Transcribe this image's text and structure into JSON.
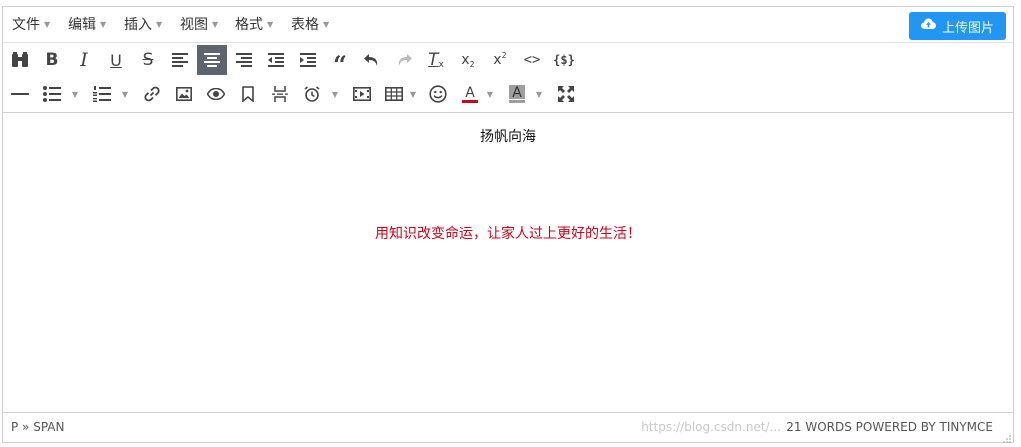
{
  "menubar": {
    "items": [
      "文件",
      "编辑",
      "插入",
      "视图",
      "格式",
      "表格"
    ]
  },
  "upload_button": {
    "label": "上传图片",
    "icon": "cloud-upload-icon",
    "color": "#2196f3"
  },
  "toolbar": {
    "row1": [
      "binoculars-icon",
      "bold-icon",
      "italic-icon",
      "underline-icon",
      "strikethrough-icon",
      "align-left-icon",
      "align-center-icon",
      "align-right-icon",
      "outdent-icon",
      "indent-icon",
      "blockquote-icon",
      "undo-icon",
      "redo-icon",
      "clear-format-icon",
      "subscript-icon",
      "superscript-icon",
      "code-icon",
      "code-sample-icon"
    ],
    "row2": [
      "horizontal-rule-icon",
      "bullet-list-icon",
      "numbered-list-icon",
      "link-icon",
      "image-icon",
      "preview-icon",
      "bookmark-icon",
      "page-break-icon",
      "clock-icon",
      "media-icon",
      "table-icon",
      "emoticons-icon",
      "text-color-icon",
      "background-color-icon",
      "fullscreen-icon"
    ],
    "active": "align-center-icon",
    "text_color": "#d0021b",
    "bg_color_swatch": "#9e9e9e"
  },
  "content": {
    "line1": "扬帆向海",
    "line2": "用知识改变命运，让家人过上更好的生活！",
    "line2_color": "#d0021b"
  },
  "statusbar": {
    "path": "P » SPAN",
    "word_count": "21 WORDS POWERED BY TINYMCE",
    "watermark": "https://blog.csdn.net/..."
  }
}
